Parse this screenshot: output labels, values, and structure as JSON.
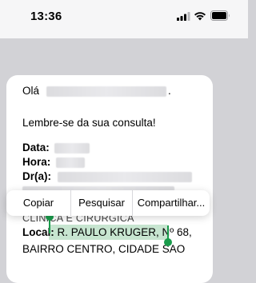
{
  "status_bar": {
    "time": "13:36",
    "icons": [
      "cellular-signal-icon",
      "wifi-icon",
      "battery-icon"
    ]
  },
  "message": {
    "greeting": "Olá",
    "greeting_end": ".",
    "reminder": "Lembre-se da sua consulta!",
    "fields": {
      "date_label": "Data:",
      "time_label": "Hora:",
      "doctor_label": "Dr(a):",
      "location_label": "Local:"
    },
    "clinic_line": "CLINICA E CIRURGICA",
    "address_selected": "R. PAULO KRUGER, Nº 68,",
    "address_line2": "BAIRRO CENTRO, CIDADE SAO"
  },
  "context_menu": {
    "items": [
      "Copiar",
      "Pesquisar",
      "Compartilhar..."
    ]
  },
  "colors": {
    "selection_highlight": "#c7e5d0",
    "selection_handle": "#1a9c4c",
    "background": "#d2d2d6"
  }
}
